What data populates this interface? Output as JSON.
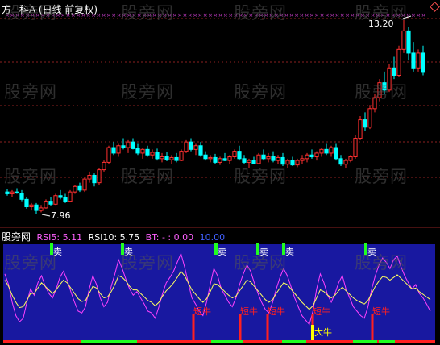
{
  "header": {
    "title": "方",
    "stock": "科A",
    "period": "(日线 前复权)"
  },
  "price_labels": {
    "high": "13.20",
    "low": "7.96"
  },
  "indicator": {
    "name": "股旁网",
    "rsi5_label": "RSI5:",
    "rsi5_value": "5.11",
    "rsi10_label": "RSI10:",
    "rsi10_value": "5.75",
    "bt_label": "BT:",
    "bt_value": "- : 0.00",
    "last_value": "10.00"
  },
  "signals": {
    "sell": "卖",
    "short_bull": "短牛",
    "big_bull": "大牛"
  },
  "watermark": "股旁网",
  "colors": {
    "up": "#ff3030",
    "down": "#00ffff",
    "rsi5": "#ff40ff",
    "rsi10": "#ffff60",
    "panel_bg": "#1818a0",
    "sell": "#20ff20",
    "bull": "#ff2020",
    "big_bull": "#ffff00"
  },
  "chart_data": [
    {
      "type": "candlestick",
      "title": "",
      "ohlc": [
        [
          8.55,
          8.62,
          8.45,
          8.5
        ],
        [
          8.5,
          8.6,
          8.4,
          8.55
        ],
        [
          8.55,
          8.65,
          8.5,
          8.52
        ],
        [
          8.52,
          8.6,
          8.3,
          8.35
        ],
        [
          8.35,
          8.4,
          8.1,
          8.15
        ],
        [
          8.15,
          8.25,
          8.05,
          8.2
        ],
        [
          8.2,
          8.25,
          7.96,
          8.05
        ],
        [
          8.05,
          8.2,
          8.0,
          8.12
        ],
        [
          8.12,
          8.35,
          8.1,
          8.3
        ],
        [
          8.3,
          8.4,
          8.18,
          8.22
        ],
        [
          8.22,
          8.5,
          8.2,
          8.45
        ],
        [
          8.45,
          8.6,
          8.35,
          8.4
        ],
        [
          8.4,
          8.5,
          8.25,
          8.3
        ],
        [
          8.3,
          8.6,
          8.28,
          8.55
        ],
        [
          8.55,
          8.75,
          8.5,
          8.7
        ],
        [
          8.7,
          8.8,
          8.55,
          8.6
        ],
        [
          8.6,
          8.95,
          8.55,
          8.9
        ],
        [
          8.9,
          9.1,
          8.8,
          9.0
        ],
        [
          9.0,
          9.05,
          8.7,
          8.8
        ],
        [
          8.8,
          9.2,
          8.75,
          9.15
        ],
        [
          9.15,
          9.4,
          9.1,
          9.35
        ],
        [
          9.35,
          9.8,
          9.3,
          9.75
        ],
        [
          9.75,
          9.9,
          9.55,
          9.6
        ],
        [
          9.6,
          9.85,
          9.5,
          9.8
        ],
        [
          9.8,
          10.0,
          9.7,
          9.75
        ],
        [
          9.75,
          9.95,
          9.6,
          9.9
        ],
        [
          9.9,
          10.0,
          9.7,
          9.72
        ],
        [
          9.72,
          9.85,
          9.55,
          9.6
        ],
        [
          9.6,
          9.75,
          9.45,
          9.7
        ],
        [
          9.7,
          9.8,
          9.5,
          9.55
        ],
        [
          9.55,
          9.7,
          9.45,
          9.62
        ],
        [
          9.62,
          9.72,
          9.4,
          9.45
        ],
        [
          9.45,
          9.6,
          9.35,
          9.5
        ],
        [
          9.5,
          9.62,
          9.38,
          9.42
        ],
        [
          9.42,
          9.55,
          9.3,
          9.48
        ],
        [
          9.48,
          9.6,
          9.35,
          9.4
        ],
        [
          9.4,
          9.7,
          9.38,
          9.65
        ],
        [
          9.65,
          9.95,
          9.6,
          9.9
        ],
        [
          9.9,
          10.0,
          9.65,
          9.7
        ],
        [
          9.7,
          9.85,
          9.55,
          9.8
        ],
        [
          9.8,
          9.9,
          9.5,
          9.55
        ],
        [
          9.55,
          9.65,
          9.4,
          9.45
        ],
        [
          9.45,
          9.55,
          9.35,
          9.48
        ],
        [
          9.48,
          9.58,
          9.3,
          9.35
        ],
        [
          9.35,
          9.5,
          9.28,
          9.45
        ],
        [
          9.45,
          9.6,
          9.38,
          9.4
        ],
        [
          9.4,
          9.55,
          9.3,
          9.5
        ],
        [
          9.5,
          9.7,
          9.45,
          9.65
        ],
        [
          9.65,
          9.8,
          9.4,
          9.45
        ],
        [
          9.45,
          9.55,
          9.3,
          9.35
        ],
        [
          9.35,
          9.45,
          9.2,
          9.4
        ],
        [
          9.4,
          9.5,
          9.3,
          9.32
        ],
        [
          9.32,
          9.6,
          9.3,
          9.55
        ],
        [
          9.55,
          9.7,
          9.4,
          9.45
        ],
        [
          9.45,
          9.6,
          9.35,
          9.5
        ],
        [
          9.5,
          9.65,
          9.35,
          9.4
        ],
        [
          9.4,
          9.55,
          9.3,
          9.48
        ],
        [
          9.48,
          9.6,
          9.25,
          9.3
        ],
        [
          9.3,
          9.45,
          9.2,
          9.4
        ],
        [
          9.4,
          9.5,
          9.25,
          9.28
        ],
        [
          9.28,
          9.45,
          9.22,
          9.4
        ],
        [
          9.4,
          9.55,
          9.3,
          9.45
        ],
        [
          9.45,
          9.6,
          9.35,
          9.55
        ],
        [
          9.55,
          9.7,
          9.45,
          9.5
        ],
        [
          9.5,
          9.65,
          9.4,
          9.6
        ],
        [
          9.6,
          9.75,
          9.5,
          9.7
        ],
        [
          9.7,
          9.85,
          9.55,
          9.6
        ],
        [
          9.6,
          9.8,
          9.5,
          9.75
        ],
        [
          9.75,
          9.85,
          9.4,
          9.45
        ],
        [
          9.45,
          9.55,
          9.25,
          9.3
        ],
        [
          9.3,
          9.45,
          9.2,
          9.4
        ],
        [
          9.4,
          9.55,
          9.35,
          9.5
        ],
        [
          9.5,
          10.1,
          9.45,
          10.0
        ],
        [
          10.0,
          10.6,
          9.95,
          10.5
        ],
        [
          10.5,
          10.7,
          10.2,
          10.3
        ],
        [
          10.3,
          10.9,
          10.25,
          10.8
        ],
        [
          10.8,
          11.2,
          10.7,
          11.1
        ],
        [
          11.1,
          11.6,
          11.0,
          11.5
        ],
        [
          11.5,
          11.8,
          11.2,
          11.3
        ],
        [
          11.3,
          12.0,
          11.25,
          11.9
        ],
        [
          11.9,
          12.2,
          11.6,
          11.7
        ],
        [
          11.7,
          12.5,
          11.65,
          12.4
        ],
        [
          12.4,
          13.2,
          12.3,
          12.9
        ],
        [
          12.9,
          13.0,
          12.1,
          12.3
        ],
        [
          12.3,
          12.6,
          11.8,
          11.9
        ],
        [
          11.9,
          12.4,
          11.8,
          12.3
        ],
        [
          12.3,
          12.5,
          11.7,
          11.8
        ]
      ]
    },
    {
      "type": "line",
      "title": "",
      "series": [
        {
          "name": "RSI5",
          "values": [
            72,
            60,
            40,
            25,
            18,
            22,
            40,
            55,
            48,
            62,
            70,
            58,
            50,
            45,
            55,
            68,
            75,
            65,
            52,
            40,
            30,
            28,
            35,
            55,
            70,
            60,
            45,
            35,
            40,
            58,
            72,
            88,
            78,
            66,
            55,
            48,
            52,
            45,
            38,
            30,
            28,
            22,
            35,
            50,
            62,
            68,
            75,
            85,
            95,
            80,
            62,
            45,
            38,
            30,
            25,
            40,
            60,
            78,
            70,
            55,
            48,
            40,
            35,
            45,
            60,
            72,
            82,
            75,
            62,
            50,
            40,
            32,
            28,
            40,
            55,
            68,
            78,
            70,
            58,
            45,
            35,
            25,
            20,
            15,
            30,
            55,
            72,
            62,
            48,
            40,
            50,
            62,
            70,
            55,
            45,
            35,
            30,
            25,
            22,
            35,
            55,
            70,
            82,
            90,
            85,
            78,
            88,
            92,
            80,
            70,
            62,
            55,
            60,
            50,
            45,
            38,
            30
          ]
        },
        {
          "name": "RSI10",
          "values": [
            65,
            58,
            48,
            40,
            34,
            35,
            42,
            50,
            50,
            56,
            62,
            58,
            54,
            50,
            54,
            60,
            65,
            62,
            56,
            50,
            44,
            41,
            42,
            50,
            58,
            56,
            50,
            45,
            46,
            52,
            60,
            70,
            68,
            64,
            58,
            54,
            54,
            50,
            46,
            42,
            40,
            36,
            40,
            47,
            53,
            57,
            62,
            68,
            75,
            70,
            62,
            54,
            49,
            44,
            40,
            44,
            52,
            61,
            60,
            56,
            52,
            48,
            45,
            47,
            53,
            59,
            65,
            63,
            58,
            53,
            48,
            43,
            40,
            43,
            50,
            56,
            62,
            60,
            55,
            50,
            45,
            40,
            36,
            32,
            36,
            45,
            54,
            52,
            48,
            45,
            48,
            53,
            57,
            53,
            49,
            45,
            42,
            40,
            38,
            42,
            50,
            58,
            64,
            69,
            68,
            65,
            68,
            71,
            67,
            63,
            59,
            55,
            56,
            52,
            49,
            46,
            43
          ]
        }
      ],
      "ylim": [
        0,
        100
      ]
    }
  ]
}
